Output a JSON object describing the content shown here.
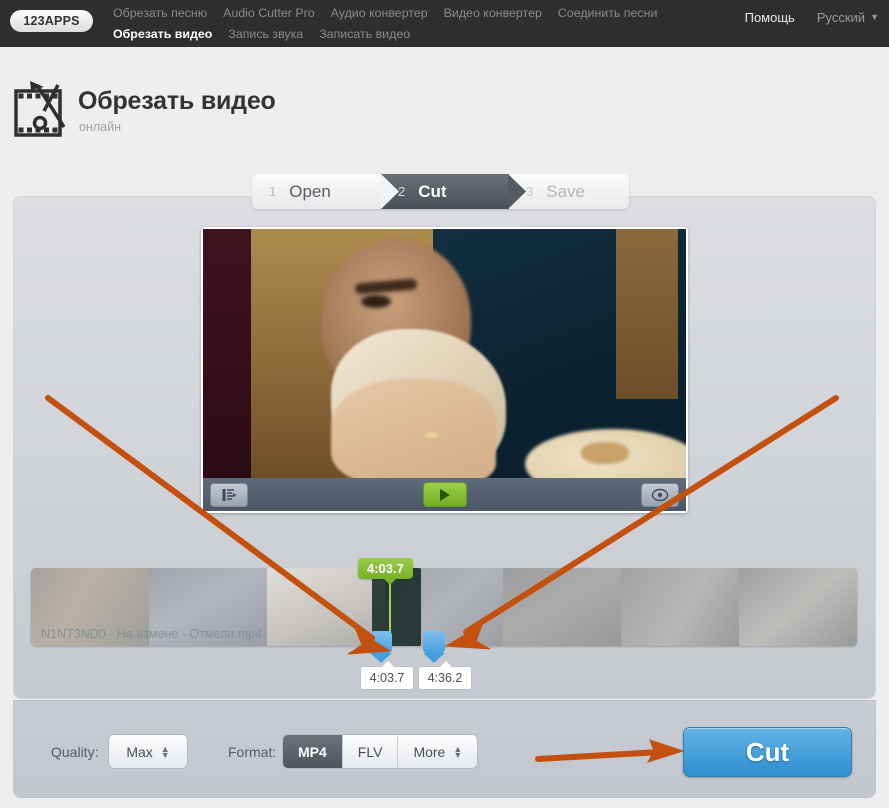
{
  "header": {
    "logo": "123APPS",
    "nav_row1": [
      {
        "label": "Обрезать песню",
        "active": false
      },
      {
        "label": "Audio Cutter Pro",
        "active": false
      },
      {
        "label": "Аудио конвертер",
        "active": false
      },
      {
        "label": "Видео конвертер",
        "active": false
      },
      {
        "label": "Соединить песни",
        "active": false
      }
    ],
    "nav_row2": [
      {
        "label": "Обрезать видео",
        "active": true
      },
      {
        "label": "Запись звука",
        "active": false
      },
      {
        "label": "Записать видео",
        "active": false
      }
    ],
    "help_label": "Помощь",
    "language_label": "Русский",
    "caret": "▼"
  },
  "page": {
    "title": "Обрезать видео",
    "subtitle": "онлайн",
    "icon": "film-scissors-icon"
  },
  "steps": [
    {
      "number": "1",
      "label": "Open",
      "state": "done"
    },
    {
      "number": "2",
      "label": "Cut",
      "state": "active"
    },
    {
      "number": "3",
      "label": "Save",
      "state": "upcoming"
    }
  ],
  "player": {
    "prev_button_icon": "frame-step-icon",
    "play_button_icon": "play-icon",
    "volume_button_icon": "disc-icon"
  },
  "timeline": {
    "filename": "N1NT3ND0 - На измене - Отмели.mp4",
    "current_time_bubble": "4:03.7",
    "start_time": "4:03.7",
    "end_time": "4:36.2",
    "left_handle_name": "trim-start-handle",
    "right_handle_name": "trim-end-handle"
  },
  "bottom": {
    "quality_label": "Quality:",
    "quality_value": "Max",
    "format_label": "Format:",
    "formats": [
      {
        "label": "MP4",
        "active": true
      },
      {
        "label": "FLV",
        "active": false
      },
      {
        "label": "More",
        "active": false,
        "stepper": true
      }
    ],
    "cut_button": "Cut"
  },
  "colors": {
    "topbar": "#2e2e2e",
    "accent_blue": "#2f8fd1",
    "accent_green": "#77b029",
    "annotation_orange": "#c4500f",
    "panel": "#d2d6da"
  }
}
